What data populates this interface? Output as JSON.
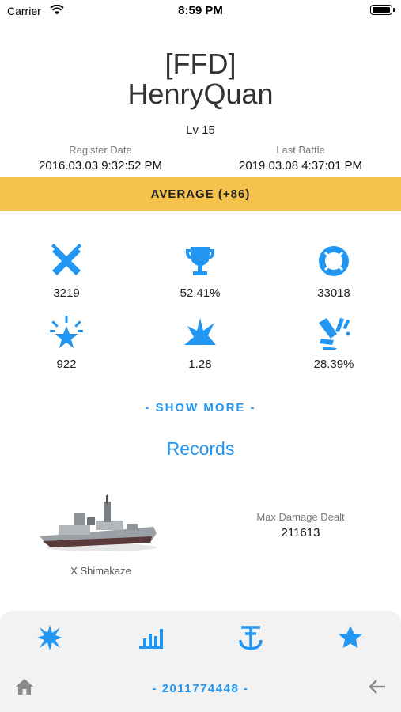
{
  "status_bar": {
    "carrier": "Carrier",
    "time": "8:59 PM"
  },
  "player": {
    "clan_tag": "[FFD]",
    "name": "HenryQuan",
    "level": "Lv 15"
  },
  "dates": {
    "register_label": "Register Date",
    "register_value": "2016.03.03 9:32:52 PM",
    "last_battle_label": "Last Battle",
    "last_battle_value": "2019.03.08 4:37:01 PM"
  },
  "rating_banner": {
    "text": "AVERAGE (+86)",
    "color": "#f5c24c"
  },
  "stats": [
    {
      "icon": "crossed-swords-icon",
      "value": "3219"
    },
    {
      "icon": "trophy-icon",
      "value": "52.41%"
    },
    {
      "icon": "life-ring-icon",
      "value": "33018"
    },
    {
      "icon": "star-burst-icon",
      "value": "922"
    },
    {
      "icon": "explosion-icon",
      "value": "1.28"
    },
    {
      "icon": "shell-hit-icon",
      "value": "28.39%"
    }
  ],
  "show_more": "- SHOW MORE -",
  "records": {
    "title": "Records",
    "ship_name": "X Shimakaze",
    "stat_label": "Max Damage Dealt",
    "stat_value": "211613"
  },
  "bottom_tabs": [
    "burst-star-icon",
    "bar-chart-icon",
    "anchor-icon",
    "star-icon"
  ],
  "footer": {
    "account_id": "- 2011774448 -",
    "home_icon": "home-icon",
    "back_icon": "back-arrow-icon"
  },
  "accent_color": "#2196f3"
}
